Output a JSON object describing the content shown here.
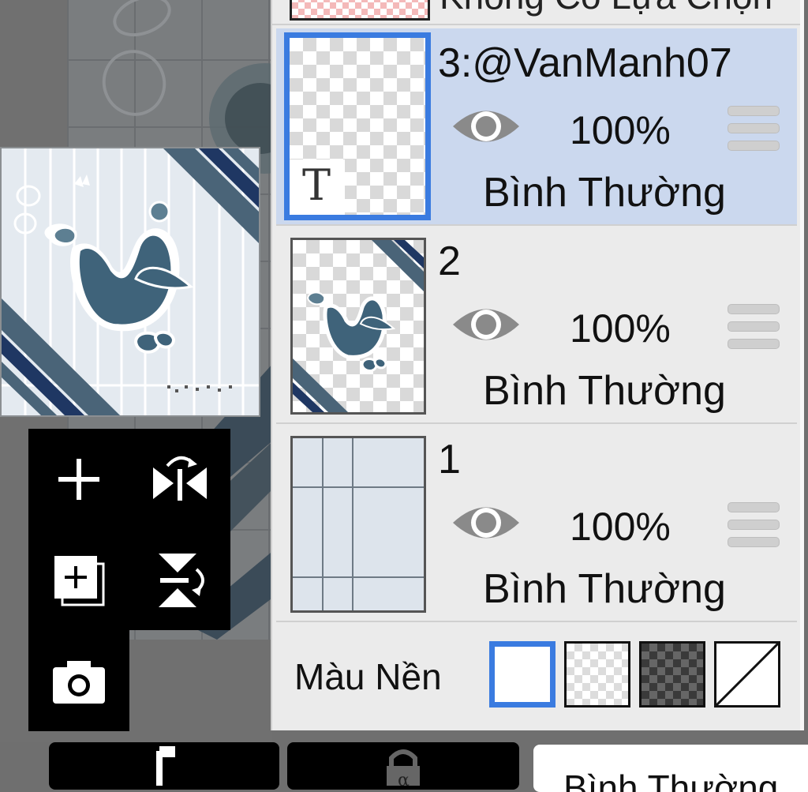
{
  "layer_panel": {
    "no_selection_label": "Không Có Lựa Chọn",
    "layers": [
      {
        "name": "3:@VanManh07",
        "opacity": "100%",
        "blend_mode": "Bình Thường",
        "selected": true,
        "type": "text"
      },
      {
        "name": "2",
        "opacity": "100%",
        "blend_mode": "Bình Thường",
        "selected": false,
        "type": "image"
      },
      {
        "name": "1",
        "opacity": "100%",
        "blend_mode": "Bình Thường",
        "selected": false,
        "type": "grid"
      }
    ],
    "text_layer_glyph": "T",
    "background_color": {
      "label": "Màu Nền",
      "options": [
        "white",
        "light-checker",
        "dark-checker",
        "none"
      ],
      "selected": "white"
    }
  },
  "tools": [
    "add-layer-icon",
    "flip-horizontal-icon",
    "duplicate-layer-icon",
    "flip-vertical-icon",
    "camera-icon"
  ],
  "bottom_bar": {
    "blend_mode_label": "Bình Thường",
    "buttons": [
      "undo-arrow-icon",
      "alpha-lock-icon"
    ]
  },
  "colors": {
    "selection_accent": "#3a7be0",
    "selected_row_bg": "#cbd8ee",
    "panel_bg": "#ebebeb",
    "artwork_blue": "#3c5a72"
  }
}
